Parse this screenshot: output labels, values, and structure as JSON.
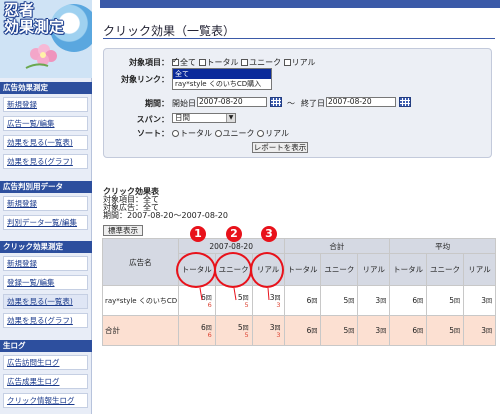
{
  "logo": {
    "line1": "忍者",
    "line2": "効果測定"
  },
  "sidebar": {
    "sections": [
      {
        "title": "広告効果測定",
        "items": [
          "新規登録",
          "広告一覧/編集",
          "効果を見る(一覧表)",
          "効果を見る(グラフ)"
        ]
      },
      {
        "title": "広告判別用データ",
        "items": [
          "新規登録",
          "判別データ一覧/編集"
        ]
      },
      {
        "title": "クリック効果測定",
        "items": [
          "新規登録",
          "登録一覧/編集",
          "効果を見る(一覧表)",
          "効果を見る(グラフ)"
        ]
      },
      {
        "title": "生ログ",
        "items": [
          "広告訪問生ログ",
          "広告成果生ログ",
          "クリック情報生ログ"
        ]
      }
    ]
  },
  "page_title": "クリック効果（一覧表）",
  "form": {
    "target_item_label": "対象項目：",
    "target_items": [
      {
        "label": "全て",
        "checked": true
      },
      {
        "label": "トータル",
        "checked": false
      },
      {
        "label": "ユニーク",
        "checked": false
      },
      {
        "label": "リアル",
        "checked": false
      }
    ],
    "target_link_label": "対象リンク：",
    "link_options": [
      "全て",
      "ray*style くのいちCD購入"
    ],
    "period_label": "期間：",
    "start_label": "開始日",
    "start_value": "2007-08-20",
    "tilde": "～",
    "end_label": "終了日",
    "end_value": "2007-08-20",
    "span_label": "スパン：",
    "span_value": "日間",
    "sort_label": "ソート：",
    "sort_options": [
      {
        "label": "トータル",
        "checked": false
      },
      {
        "label": "ユニーク",
        "checked": false
      },
      {
        "label": "リアル",
        "checked": false
      }
    ],
    "submit_label": "レポートを表示"
  },
  "summary": {
    "title": "クリック効果表",
    "items": "対象項目：全て",
    "ads": "対象広告：全て",
    "period": "期間：2007-08-20～2007-08-20"
  },
  "standard_button": "標準表示",
  "table": {
    "name_header": "広告名",
    "groups": [
      "2007-08-20",
      "合計",
      "平均"
    ],
    "subheaders": [
      "トータル",
      "ユニーク",
      "リアル"
    ],
    "unit": "回",
    "rows": [
      {
        "name": "ray*style くのいちCD",
        "values": [
          "6",
          "5",
          "3",
          "6",
          "5",
          "3",
          "6",
          "5",
          "3"
        ],
        "subvalues": [
          "6",
          "5",
          "3"
        ]
      },
      {
        "name": "合計",
        "values": [
          "6",
          "5",
          "3",
          "6",
          "5",
          "3",
          "6",
          "5",
          "3"
        ],
        "subvalues": [
          "6",
          "5",
          "3"
        ]
      }
    ]
  },
  "callouts": [
    "1",
    "2",
    "3"
  ],
  "colors": {
    "accent": "#2d4f9e",
    "callout": "#e8121b",
    "total_row": "#fce0d2"
  }
}
